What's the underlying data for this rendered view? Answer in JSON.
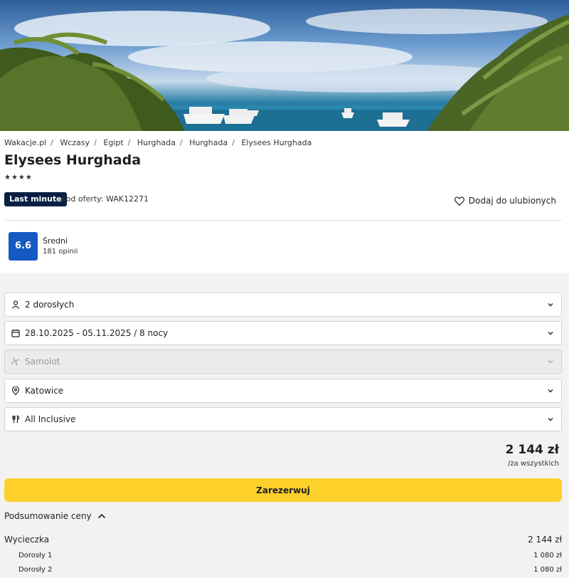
{
  "hero": {
    "image": "palm-beach-yachts-photo"
  },
  "breadcrumb": [
    "Wakacje.pl",
    "Wczasy",
    "Egipt",
    "Hurghada",
    "Hurghada",
    "Elysees Hurghada"
  ],
  "hotel": {
    "name": "Elysees Hurghada",
    "stars": "★★★★"
  },
  "offer": {
    "badge": "Last minute",
    "code": "Kod oferty: WAK12271",
    "fav_label": "Dodaj do ulubionych"
  },
  "rating": {
    "score": "6.6",
    "label": "Średni",
    "count": "181 opinii"
  },
  "form": {
    "guests": "2 dorosłych",
    "dates": "28.10.2025 - 05.11.2025 / 8 nocy",
    "transport": "Samolot",
    "departure": "Katowice",
    "board": "All Inclusive"
  },
  "price": {
    "total": "2 144 zł",
    "per": "/za wszystkich"
  },
  "book_label": "Zarezerwuj",
  "summary": {
    "toggle_label": "Podsumowanie ceny",
    "trip_label": "Wycieczka",
    "trip_value": "2 144 zł",
    "items": [
      {
        "label": "Dorosły 1",
        "value": "1 080 zł"
      },
      {
        "label": "Dorosły 2",
        "value": "1 080 zł"
      }
    ]
  }
}
